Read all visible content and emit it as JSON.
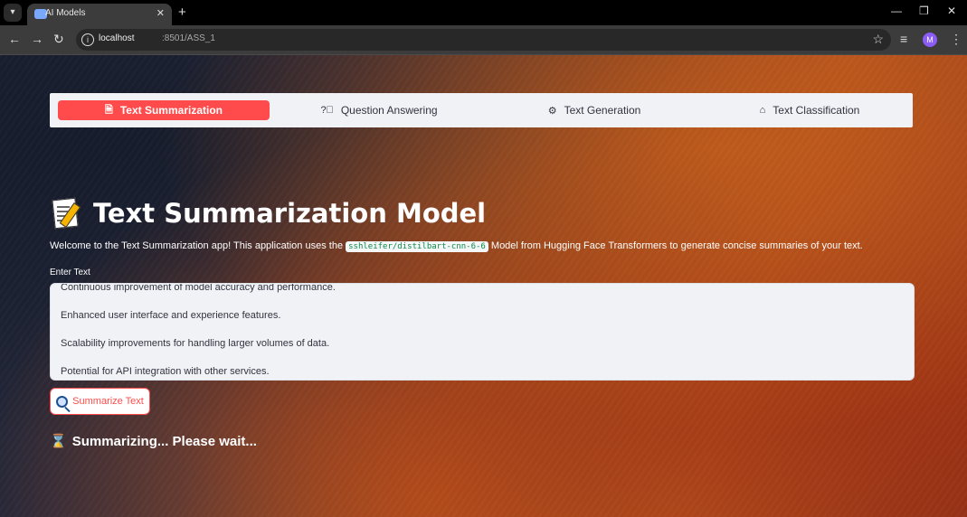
{
  "browser": {
    "tab_title": "AI Models",
    "url_host": "localhost",
    "url_path": ":8501/ASS_1",
    "profile_initial": "M",
    "icons": [
      "tab-search-icon",
      "favicon-icon",
      "close-icon",
      "plus-icon",
      "minimize-icon",
      "restore-icon",
      "close-window-icon",
      "back-icon",
      "forward-icon",
      "reload-icon",
      "info-icon",
      "star-icon",
      "media-icon",
      "kebab-icon"
    ]
  },
  "menu": {
    "items": [
      {
        "label": "Text Summarization",
        "icon": "document-icon"
      },
      {
        "label": "Question Answering",
        "icon": "help-circle-icon"
      },
      {
        "label": "Text Generation",
        "icon": "robot-icon"
      },
      {
        "label": "Text Classification",
        "icon": "tag-icon"
      }
    ],
    "active_color": "#ff4b4b"
  },
  "page": {
    "title": "Text Summarization Model",
    "intro_before": "Welcome to the Text Summarization app! This application uses the ",
    "intro_code": "sshleifer/distilbart-cnn-6-6",
    "intro_after": " Model from Hugging Face Transformers to generate concise summaries of your text.",
    "input_label": "Enter Text",
    "input_lines": [
      "Continuous improvement of model accuracy and performance.",
      "Enhanced user interface and experience features.",
      "Scalability improvements for handling larger volumes of data.",
      "Potential for API integration with other services."
    ],
    "button_label": "Summarize Text",
    "status": "Summarizing... Please wait..."
  }
}
